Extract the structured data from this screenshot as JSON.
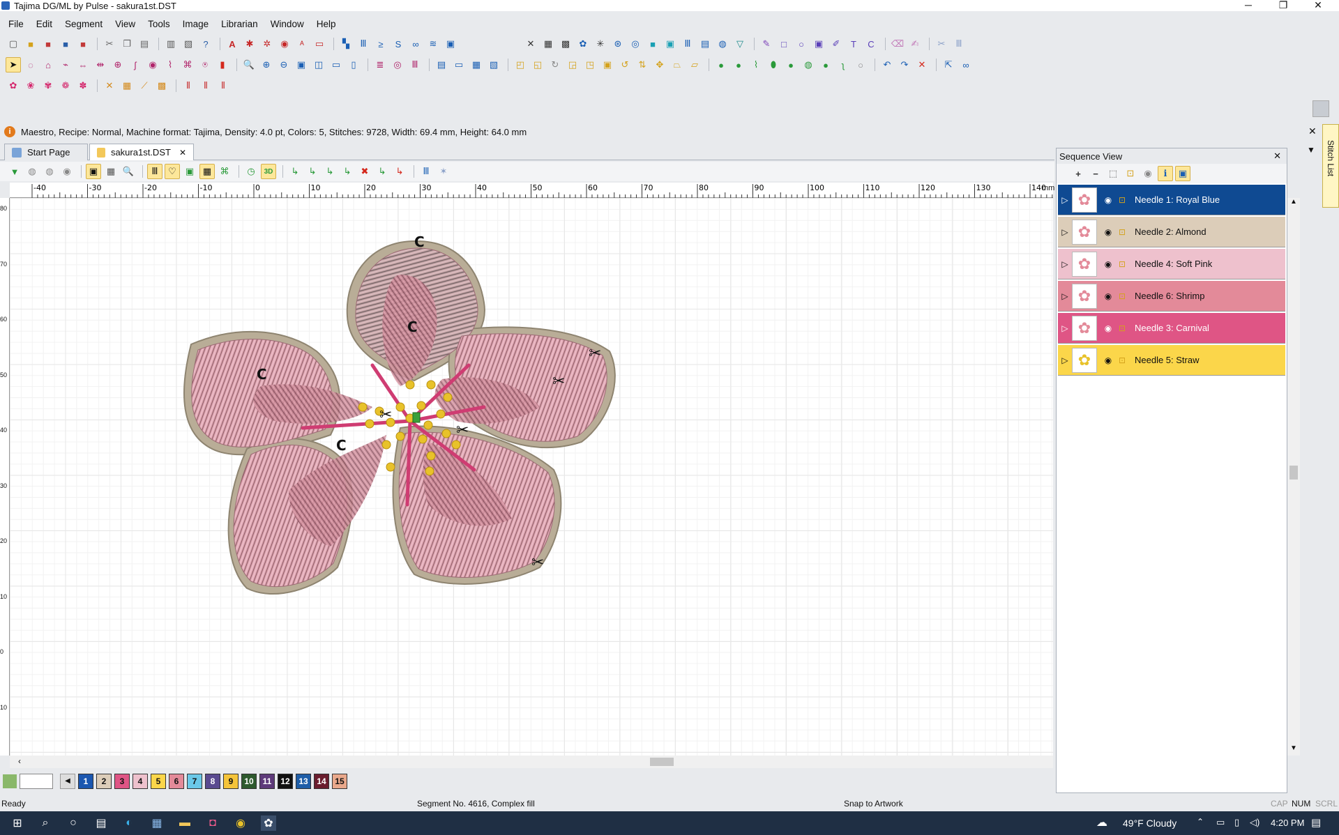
{
  "window": {
    "title": "Tajima DG/ML by Pulse - sakura1st.DST",
    "controls": [
      "─",
      "❐",
      "✕"
    ]
  },
  "menu": [
    "File",
    "Edit",
    "Segment",
    "View",
    "Tools",
    "Image",
    "Librarian",
    "Window",
    "Help"
  ],
  "infobar": {
    "text": "Maestro, Recipe: Normal, Machine format: Tajima, Density: 4.0 pt, Colors: 5, Stitches: 9728, Width: 69.4 mm, Height: 64.0 mm",
    "icon": "info-icon"
  },
  "tabs": [
    {
      "label": "Start Page",
      "active": false
    },
    {
      "label": "sakura1st.DST",
      "active": true
    }
  ],
  "ruler": {
    "h_labels": [
      "-40",
      "-30",
      "-20",
      "-10",
      "0",
      "10",
      "20",
      "30",
      "40",
      "50",
      "60",
      "70",
      "80",
      "90",
      "100",
      "110",
      "120",
      "130",
      "140"
    ],
    "unit": "mm",
    "v_labels": [
      "80",
      "70",
      "60",
      "50",
      "40",
      "30",
      "20",
      "10",
      "0",
      "10"
    ]
  },
  "canvas_marks": {
    "c": "C",
    "trim": "✂"
  },
  "sequence_view": {
    "title": "Sequence View",
    "needles": [
      {
        "label": "Needle 1: Royal Blue",
        "color": "#0f4a92",
        "text_color": "#ffffff",
        "selected": true
      },
      {
        "label": "Needle 2: Almond",
        "color": "#dccdb9",
        "text_color": "#111111",
        "selected": false
      },
      {
        "label": "Needle 4: Soft Pink",
        "color": "#eec1cd",
        "text_color": "#111111",
        "selected": false
      },
      {
        "label": "Needle 6: Shrimp",
        "color": "#e38a99",
        "text_color": "#111111",
        "selected": false
      },
      {
        "label": "Needle 3: Carnival",
        "color": "#df5585",
        "text_color": "#ffffff",
        "selected": false
      },
      {
        "label": "Needle 5: Straw",
        "color": "#fbd64a",
        "text_color": "#111111",
        "selected": false
      }
    ]
  },
  "side_tab": "Stitch List",
  "needle_buttons": [
    {
      "n": "1",
      "bg": "#1b57b0",
      "fg": "#ffffff"
    },
    {
      "n": "2",
      "bg": "#dccdb9",
      "fg": "#111111"
    },
    {
      "n": "3",
      "bg": "#df5585",
      "fg": "#111111"
    },
    {
      "n": "4",
      "bg": "#eec1cd",
      "fg": "#111111"
    },
    {
      "n": "5",
      "bg": "#fbd64a",
      "fg": "#111111"
    },
    {
      "n": "6",
      "bg": "#e38a99",
      "fg": "#111111"
    },
    {
      "n": "7",
      "bg": "#6ac8e8",
      "fg": "#111111"
    },
    {
      "n": "8",
      "bg": "#5a4a90",
      "fg": "#ffffff"
    },
    {
      "n": "9",
      "bg": "#f5c43a",
      "fg": "#111111"
    },
    {
      "n": "10",
      "bg": "#2e5a2e",
      "fg": "#ffffff"
    },
    {
      "n": "11",
      "bg": "#5e3a7a",
      "fg": "#ffffff"
    },
    {
      "n": "12",
      "bg": "#111111",
      "fg": "#ffffff"
    },
    {
      "n": "13",
      "bg": "#1f5ea8",
      "fg": "#ffffff"
    },
    {
      "n": "14",
      "bg": "#6a1d2e",
      "fg": "#ffffff"
    },
    {
      "n": "15",
      "bg": "#e9a88b",
      "fg": "#111111"
    }
  ],
  "status": {
    "left": "Ready",
    "segment": "Segment No. 4616, Complex fill",
    "snap": "Snap to Artwork",
    "indicators": [
      "CAP",
      "NUM",
      "SCRL"
    ]
  },
  "taskbar": {
    "weather": "49°F  Cloudy",
    "time": "4:20 PM"
  }
}
